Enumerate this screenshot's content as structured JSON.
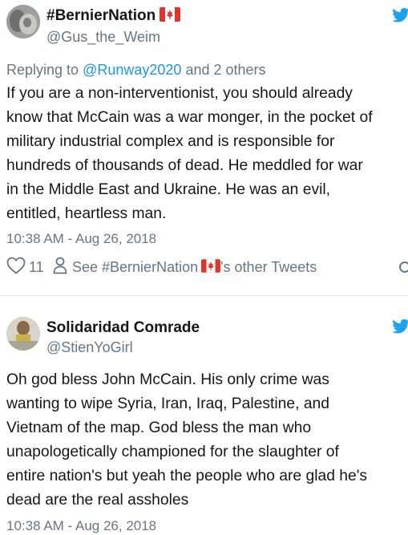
{
  "tweets": [
    {
      "author_name": "#BernierNation",
      "author_handle": "@Gus_the_Weim",
      "flag_icon": "canada-flag-icon",
      "reply_prefix": "Replying to",
      "reply_mention": "@Runway2020",
      "reply_suffix": "and 2 others",
      "text_lines": [
        "If you are a non-interventionist, you should already",
        "know that McCain was a war monger, in the pocket of",
        "military industrial complex and is responsible for",
        "hundreds of thousands of dead. He meddled for war",
        "in the Middle East and Ukraine. He was an evil,",
        "entitled, heartless man."
      ],
      "timestamp": "10:38 AM - Aug 26, 2018",
      "like_count": "11",
      "see_other_prefix": "See #BernierNation",
      "see_other_suffix": "'s other Tweets"
    },
    {
      "author_name": "Solidaridad Comrade",
      "author_handle": "@StienYoGirl",
      "text_lines": [
        "Oh god bless John McCain.  His only crime was",
        "wanting to wipe Syria, Iran, Iraq, Palestine, and",
        "Vietnam of the map.  God bless the man who",
        "unapologetically championed for the slaughter of",
        "entire nation's but yeah the people who are glad he's",
        "dead are the real assholes"
      ],
      "timestamp": "10:38 AM - Aug 26, 2018"
    }
  ],
  "colors": {
    "accent": "#1da1f2",
    "link": "#1b95e0",
    "secondary_text": "#657786",
    "like_icon": "#657786",
    "flag_red": "#e0352b"
  },
  "icons": {
    "bird": "twitter-bird-icon",
    "like": "heart-icon",
    "profile": "person-icon"
  }
}
